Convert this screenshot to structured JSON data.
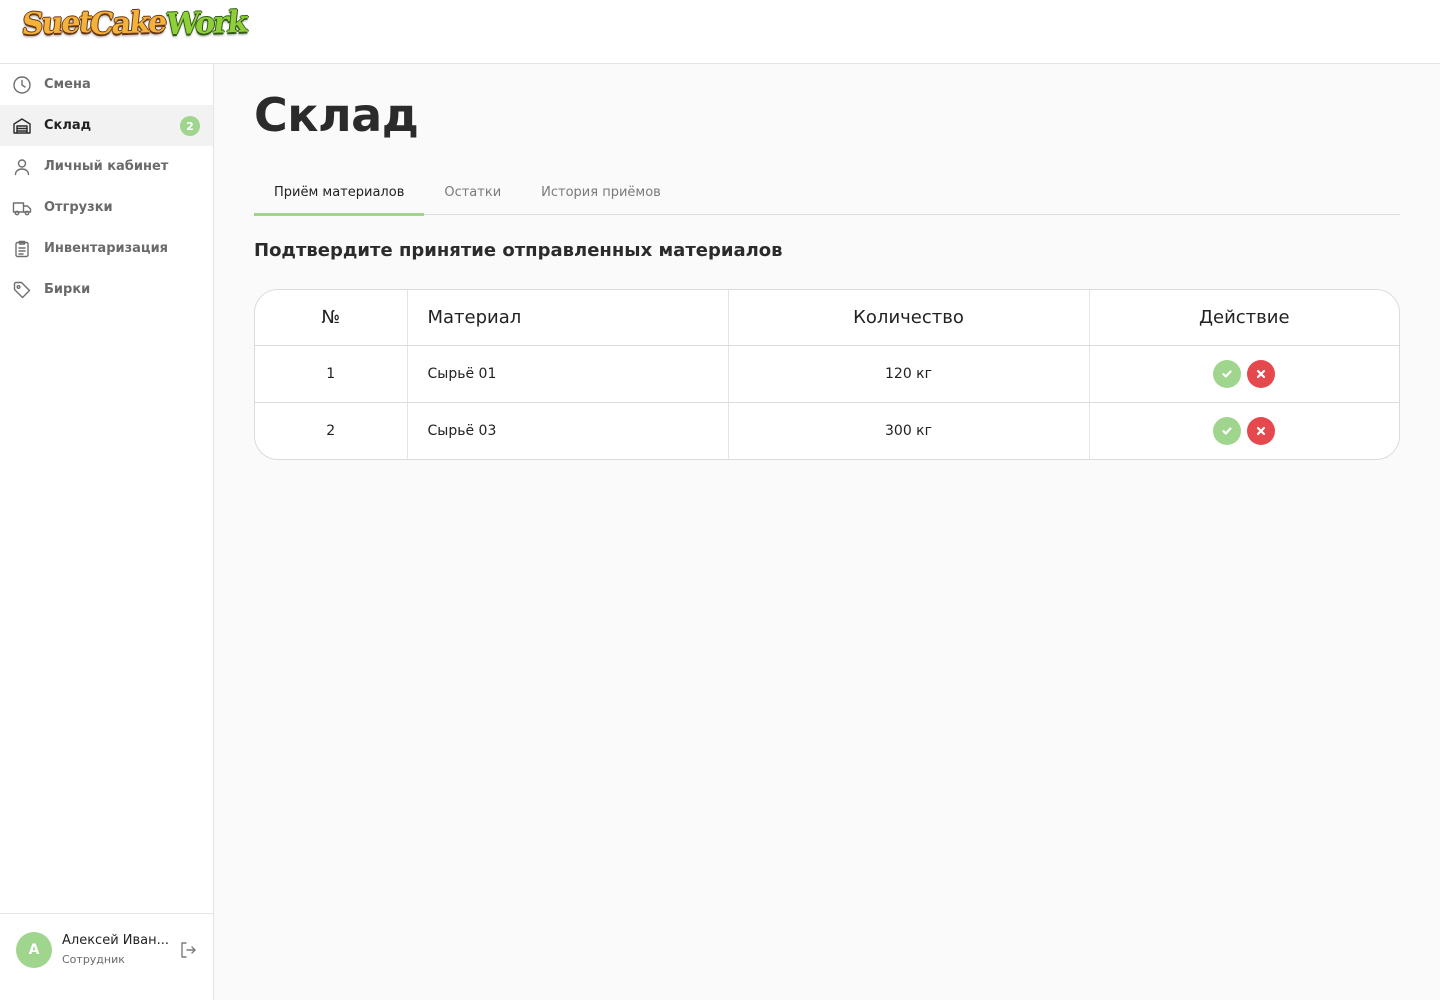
{
  "app": {
    "logo_words": [
      "Suet",
      "Cake",
      "Work"
    ]
  },
  "sidebar": {
    "items": [
      {
        "label": "Смена",
        "icon": "clock-icon"
      },
      {
        "label": "Склад",
        "icon": "warehouse-icon",
        "badge": "2",
        "active": true
      },
      {
        "label": "Личный кабинет",
        "icon": "user-icon"
      },
      {
        "label": "Отгрузки",
        "icon": "truck-icon"
      },
      {
        "label": "Инвентаризация",
        "icon": "clipboard-icon"
      },
      {
        "label": "Бирки",
        "icon": "tag-icon"
      }
    ]
  },
  "user": {
    "initial": "А",
    "name": "Алексей Иван...",
    "role": "Сотрудник"
  },
  "page": {
    "title": "Склад",
    "tabs": [
      {
        "label": "Приём материалов",
        "active": true
      },
      {
        "label": "Остатки"
      },
      {
        "label": "История приёмов"
      }
    ],
    "section_title": "Подтвердите принятие отправленных материалов"
  },
  "table": {
    "headers": [
      "№",
      "Материал",
      "Количество",
      "Действие"
    ],
    "rows": [
      {
        "num": "1",
        "material": "Сырьё 01",
        "quantity": "120 кг"
      },
      {
        "num": "2",
        "material": "Сырьё 03",
        "quantity": "300 кг"
      }
    ]
  },
  "colors": {
    "accent_green": "#9fd58d",
    "reject_red": "#e5484d"
  }
}
